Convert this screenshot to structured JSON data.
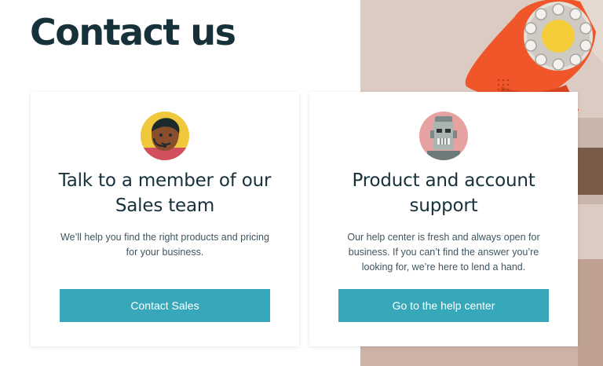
{
  "page": {
    "title": "Contact us"
  },
  "cards": [
    {
      "avatar_icon": "sales-agent-headset-icon",
      "title": "Talk to a member of our Sales team",
      "description": "We’ll help you find the right products and pricing for your business.",
      "button_label": "Contact Sales"
    },
    {
      "avatar_icon": "robot-support-icon",
      "title": "Product and account support",
      "description": "Our help center is fresh and always open for business. If you can’t find the answer you’re looking for, we’re here to lend a hand.",
      "button_label": "Go to the help center"
    }
  ],
  "colors": {
    "accent": "#37a8b9",
    "heading": "#17313b",
    "body_text": "#3f5560",
    "phone_orange": "#f0562a",
    "dial_yellow": "#f5cd3b"
  },
  "hero_image": {
    "icon": "rotary-phone-photo"
  }
}
